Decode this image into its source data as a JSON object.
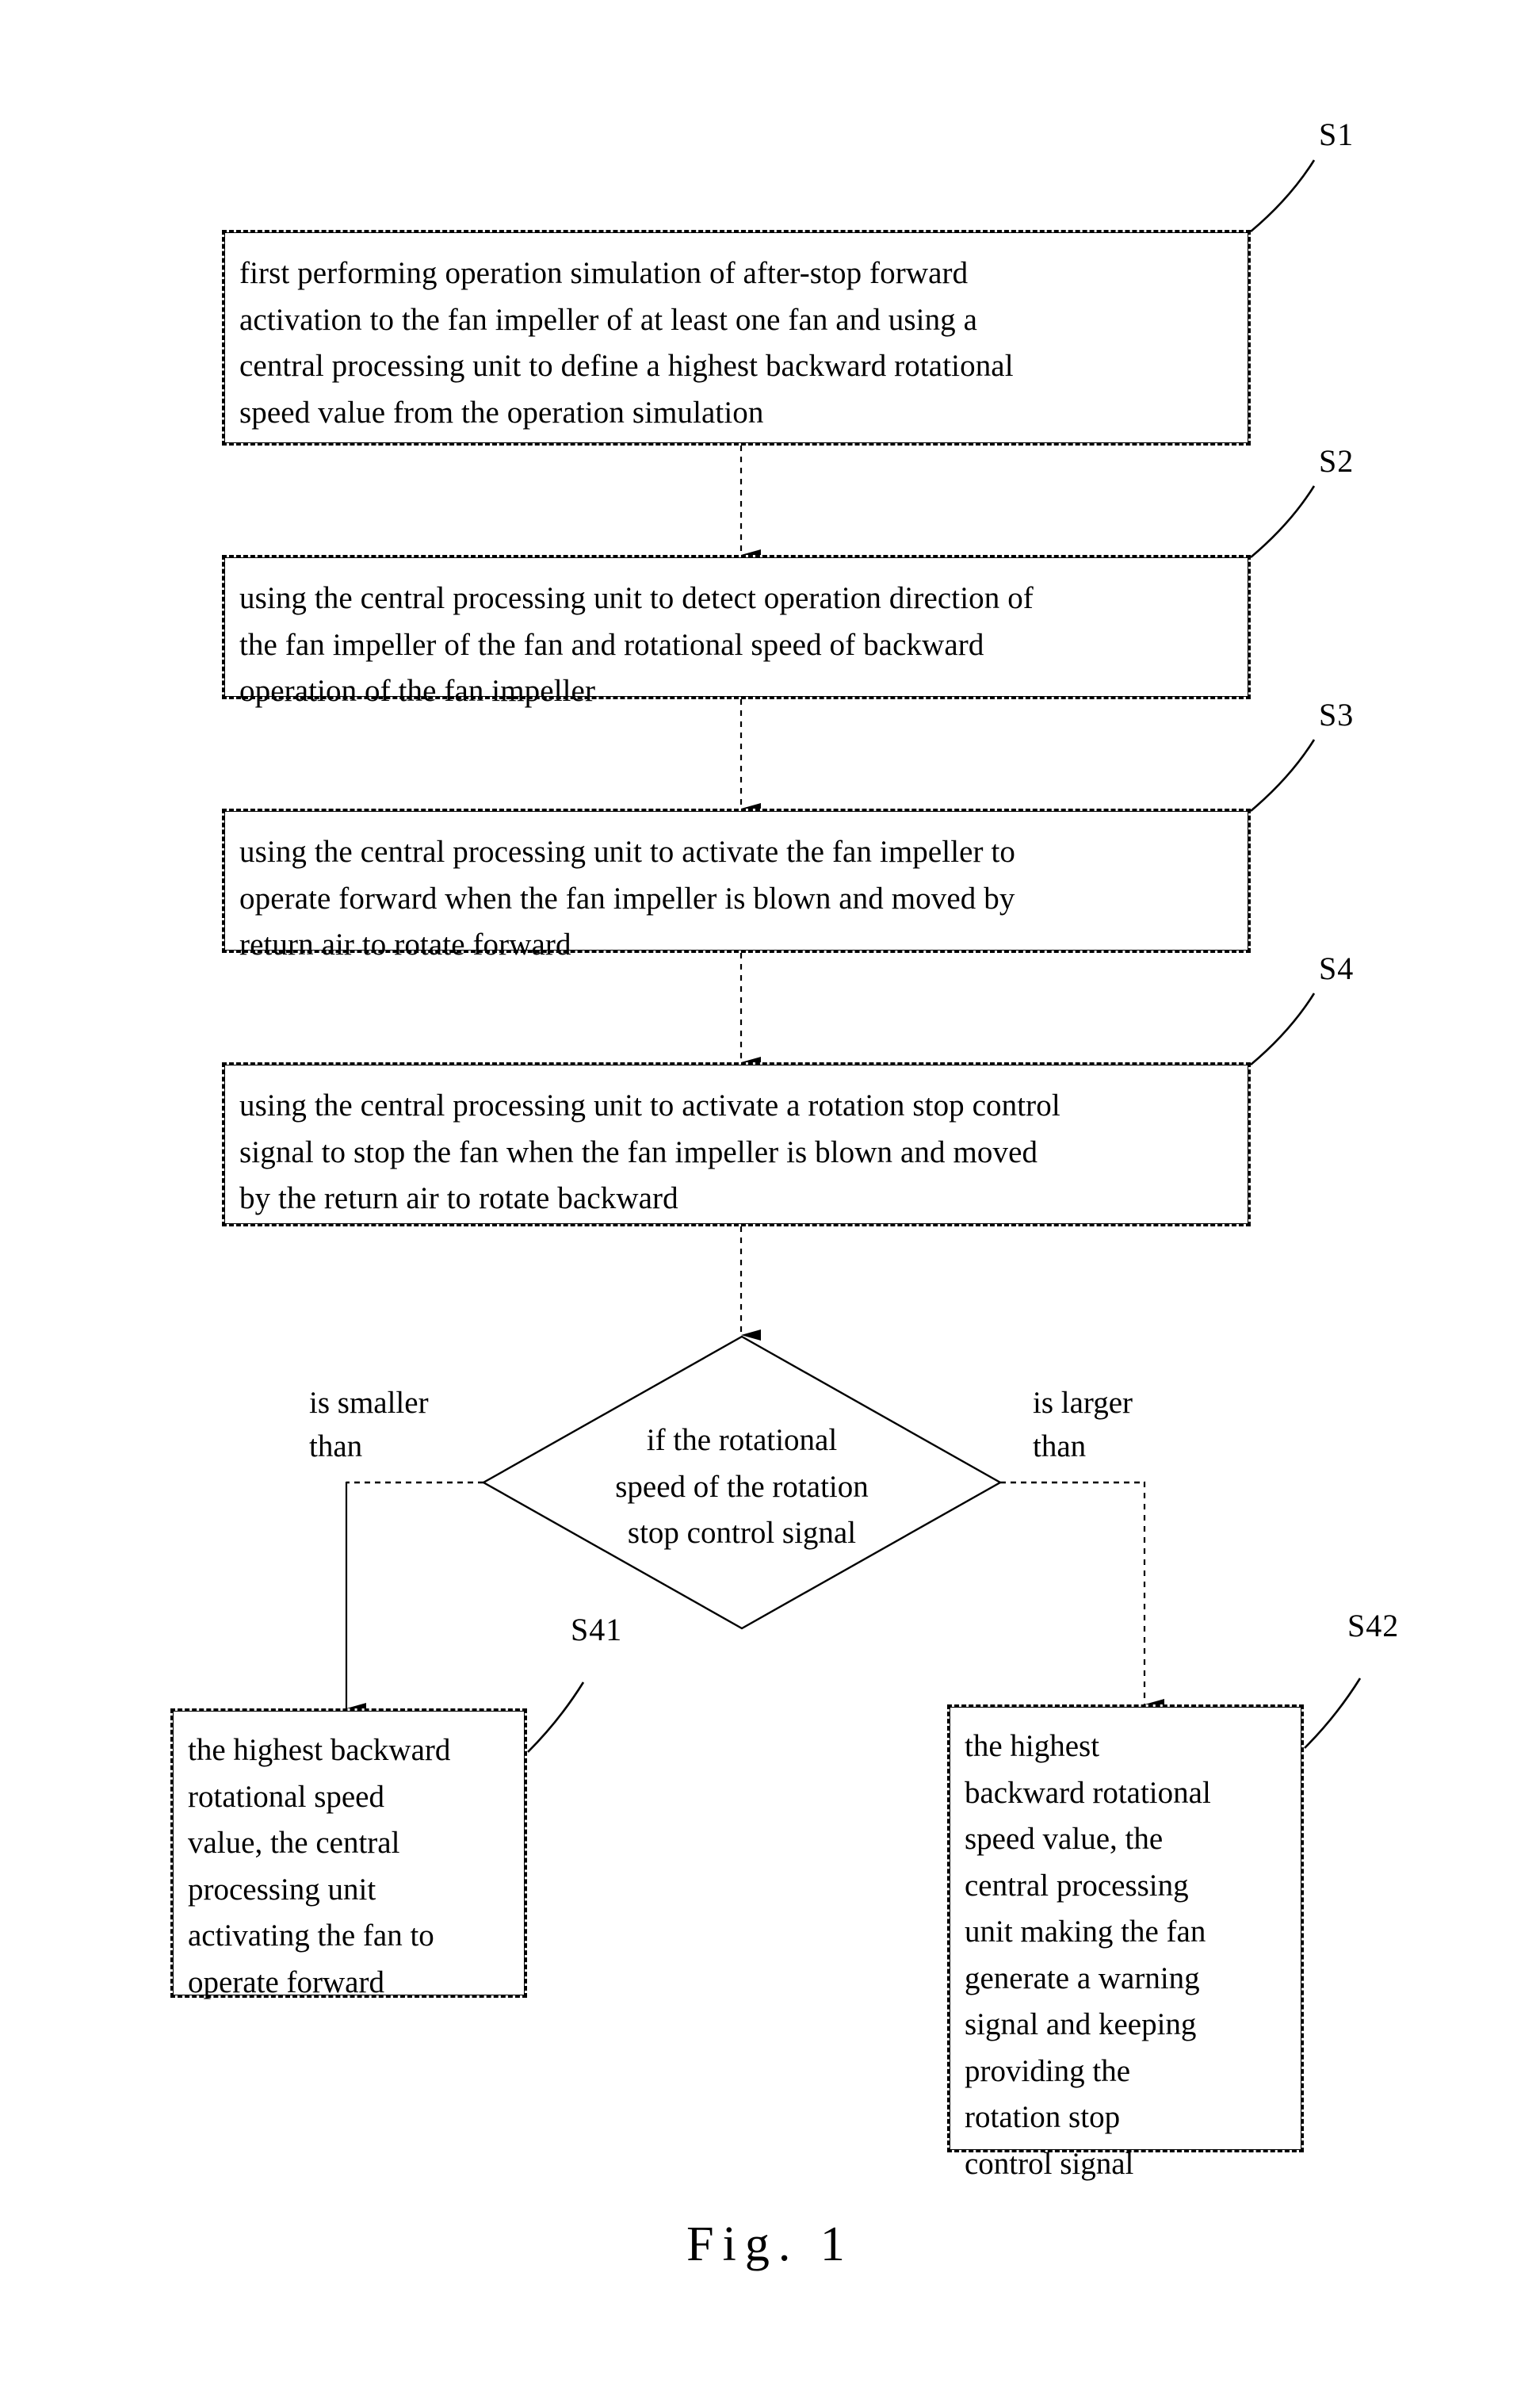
{
  "figure": {
    "caption": "Fig. 1",
    "type": "patent-flowchart"
  },
  "steps": [
    {
      "tag": "S1",
      "text": "first performing operation simulation of after-stop forward\nactivation to the fan impeller of at least one fan and using a\ncentral processing unit to define a highest backward rotational\nspeed value from the operation simulation"
    },
    {
      "tag": "S2",
      "text": "using the central processing unit to detect operation direction of\nthe fan impeller of the fan and rotational speed of backward\noperation of the fan impeller"
    },
    {
      "tag": "S3",
      "text": "using the central processing unit to activate the fan impeller to\noperate forward when the fan impeller is blown and moved by\nreturn air to rotate forward"
    },
    {
      "tag": "S4",
      "text": "using the central processing unit to activate a rotation stop control\nsignal to stop the fan when the fan impeller is blown and moved\nby the return air to rotate backward"
    }
  ],
  "decision": {
    "text": "if the rotational\nspeed of the rotation\nstop control signal",
    "branch_left_label": "is smaller\nthan",
    "branch_right_label": "is larger\nthan"
  },
  "outcomes": [
    {
      "tag": "S41",
      "text": "the highest backward\nrotational speed\nvalue, the central\nprocessing unit\nactivating the fan to\noperate forward"
    },
    {
      "tag": "S42",
      "text": "the highest\nbackward rotational\nspeed value, the\ncentral processing\nunit making the fan\ngenerate a warning\nsignal and keeping\nproviding the\nrotation stop\ncontrol signal"
    }
  ]
}
